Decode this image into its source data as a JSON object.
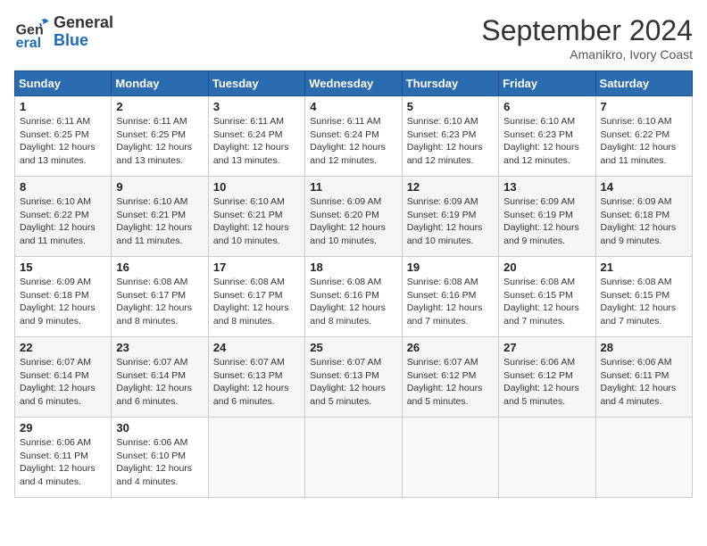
{
  "header": {
    "logo_general": "General",
    "logo_blue": "Blue",
    "month_title": "September 2024",
    "location": "Amanikro, Ivory Coast"
  },
  "days_of_week": [
    "Sunday",
    "Monday",
    "Tuesday",
    "Wednesday",
    "Thursday",
    "Friday",
    "Saturday"
  ],
  "weeks": [
    [
      {
        "day": "1",
        "sunrise": "Sunrise: 6:11 AM",
        "sunset": "Sunset: 6:25 PM",
        "daylight": "Daylight: 12 hours and 13 minutes."
      },
      {
        "day": "2",
        "sunrise": "Sunrise: 6:11 AM",
        "sunset": "Sunset: 6:25 PM",
        "daylight": "Daylight: 12 hours and 13 minutes."
      },
      {
        "day": "3",
        "sunrise": "Sunrise: 6:11 AM",
        "sunset": "Sunset: 6:24 PM",
        "daylight": "Daylight: 12 hours and 13 minutes."
      },
      {
        "day": "4",
        "sunrise": "Sunrise: 6:11 AM",
        "sunset": "Sunset: 6:24 PM",
        "daylight": "Daylight: 12 hours and 12 minutes."
      },
      {
        "day": "5",
        "sunrise": "Sunrise: 6:10 AM",
        "sunset": "Sunset: 6:23 PM",
        "daylight": "Daylight: 12 hours and 12 minutes."
      },
      {
        "day": "6",
        "sunrise": "Sunrise: 6:10 AM",
        "sunset": "Sunset: 6:23 PM",
        "daylight": "Daylight: 12 hours and 12 minutes."
      },
      {
        "day": "7",
        "sunrise": "Sunrise: 6:10 AM",
        "sunset": "Sunset: 6:22 PM",
        "daylight": "Daylight: 12 hours and 11 minutes."
      }
    ],
    [
      {
        "day": "8",
        "sunrise": "Sunrise: 6:10 AM",
        "sunset": "Sunset: 6:22 PM",
        "daylight": "Daylight: 12 hours and 11 minutes."
      },
      {
        "day": "9",
        "sunrise": "Sunrise: 6:10 AM",
        "sunset": "Sunset: 6:21 PM",
        "daylight": "Daylight: 12 hours and 11 minutes."
      },
      {
        "day": "10",
        "sunrise": "Sunrise: 6:10 AM",
        "sunset": "Sunset: 6:21 PM",
        "daylight": "Daylight: 12 hours and 10 minutes."
      },
      {
        "day": "11",
        "sunrise": "Sunrise: 6:09 AM",
        "sunset": "Sunset: 6:20 PM",
        "daylight": "Daylight: 12 hours and 10 minutes."
      },
      {
        "day": "12",
        "sunrise": "Sunrise: 6:09 AM",
        "sunset": "Sunset: 6:19 PM",
        "daylight": "Daylight: 12 hours and 10 minutes."
      },
      {
        "day": "13",
        "sunrise": "Sunrise: 6:09 AM",
        "sunset": "Sunset: 6:19 PM",
        "daylight": "Daylight: 12 hours and 9 minutes."
      },
      {
        "day": "14",
        "sunrise": "Sunrise: 6:09 AM",
        "sunset": "Sunset: 6:18 PM",
        "daylight": "Daylight: 12 hours and 9 minutes."
      }
    ],
    [
      {
        "day": "15",
        "sunrise": "Sunrise: 6:09 AM",
        "sunset": "Sunset: 6:18 PM",
        "daylight": "Daylight: 12 hours and 9 minutes."
      },
      {
        "day": "16",
        "sunrise": "Sunrise: 6:08 AM",
        "sunset": "Sunset: 6:17 PM",
        "daylight": "Daylight: 12 hours and 8 minutes."
      },
      {
        "day": "17",
        "sunrise": "Sunrise: 6:08 AM",
        "sunset": "Sunset: 6:17 PM",
        "daylight": "Daylight: 12 hours and 8 minutes."
      },
      {
        "day": "18",
        "sunrise": "Sunrise: 6:08 AM",
        "sunset": "Sunset: 6:16 PM",
        "daylight": "Daylight: 12 hours and 8 minutes."
      },
      {
        "day": "19",
        "sunrise": "Sunrise: 6:08 AM",
        "sunset": "Sunset: 6:16 PM",
        "daylight": "Daylight: 12 hours and 7 minutes."
      },
      {
        "day": "20",
        "sunrise": "Sunrise: 6:08 AM",
        "sunset": "Sunset: 6:15 PM",
        "daylight": "Daylight: 12 hours and 7 minutes."
      },
      {
        "day": "21",
        "sunrise": "Sunrise: 6:08 AM",
        "sunset": "Sunset: 6:15 PM",
        "daylight": "Daylight: 12 hours and 7 minutes."
      }
    ],
    [
      {
        "day": "22",
        "sunrise": "Sunrise: 6:07 AM",
        "sunset": "Sunset: 6:14 PM",
        "daylight": "Daylight: 12 hours and 6 minutes."
      },
      {
        "day": "23",
        "sunrise": "Sunrise: 6:07 AM",
        "sunset": "Sunset: 6:14 PM",
        "daylight": "Daylight: 12 hours and 6 minutes."
      },
      {
        "day": "24",
        "sunrise": "Sunrise: 6:07 AM",
        "sunset": "Sunset: 6:13 PM",
        "daylight": "Daylight: 12 hours and 6 minutes."
      },
      {
        "day": "25",
        "sunrise": "Sunrise: 6:07 AM",
        "sunset": "Sunset: 6:13 PM",
        "daylight": "Daylight: 12 hours and 5 minutes."
      },
      {
        "day": "26",
        "sunrise": "Sunrise: 6:07 AM",
        "sunset": "Sunset: 6:12 PM",
        "daylight": "Daylight: 12 hours and 5 minutes."
      },
      {
        "day": "27",
        "sunrise": "Sunrise: 6:06 AM",
        "sunset": "Sunset: 6:12 PM",
        "daylight": "Daylight: 12 hours and 5 minutes."
      },
      {
        "day": "28",
        "sunrise": "Sunrise: 6:06 AM",
        "sunset": "Sunset: 6:11 PM",
        "daylight": "Daylight: 12 hours and 4 minutes."
      }
    ],
    [
      {
        "day": "29",
        "sunrise": "Sunrise: 6:06 AM",
        "sunset": "Sunset: 6:11 PM",
        "daylight": "Daylight: 12 hours and 4 minutes."
      },
      {
        "day": "30",
        "sunrise": "Sunrise: 6:06 AM",
        "sunset": "Sunset: 6:10 PM",
        "daylight": "Daylight: 12 hours and 4 minutes."
      },
      null,
      null,
      null,
      null,
      null
    ]
  ]
}
